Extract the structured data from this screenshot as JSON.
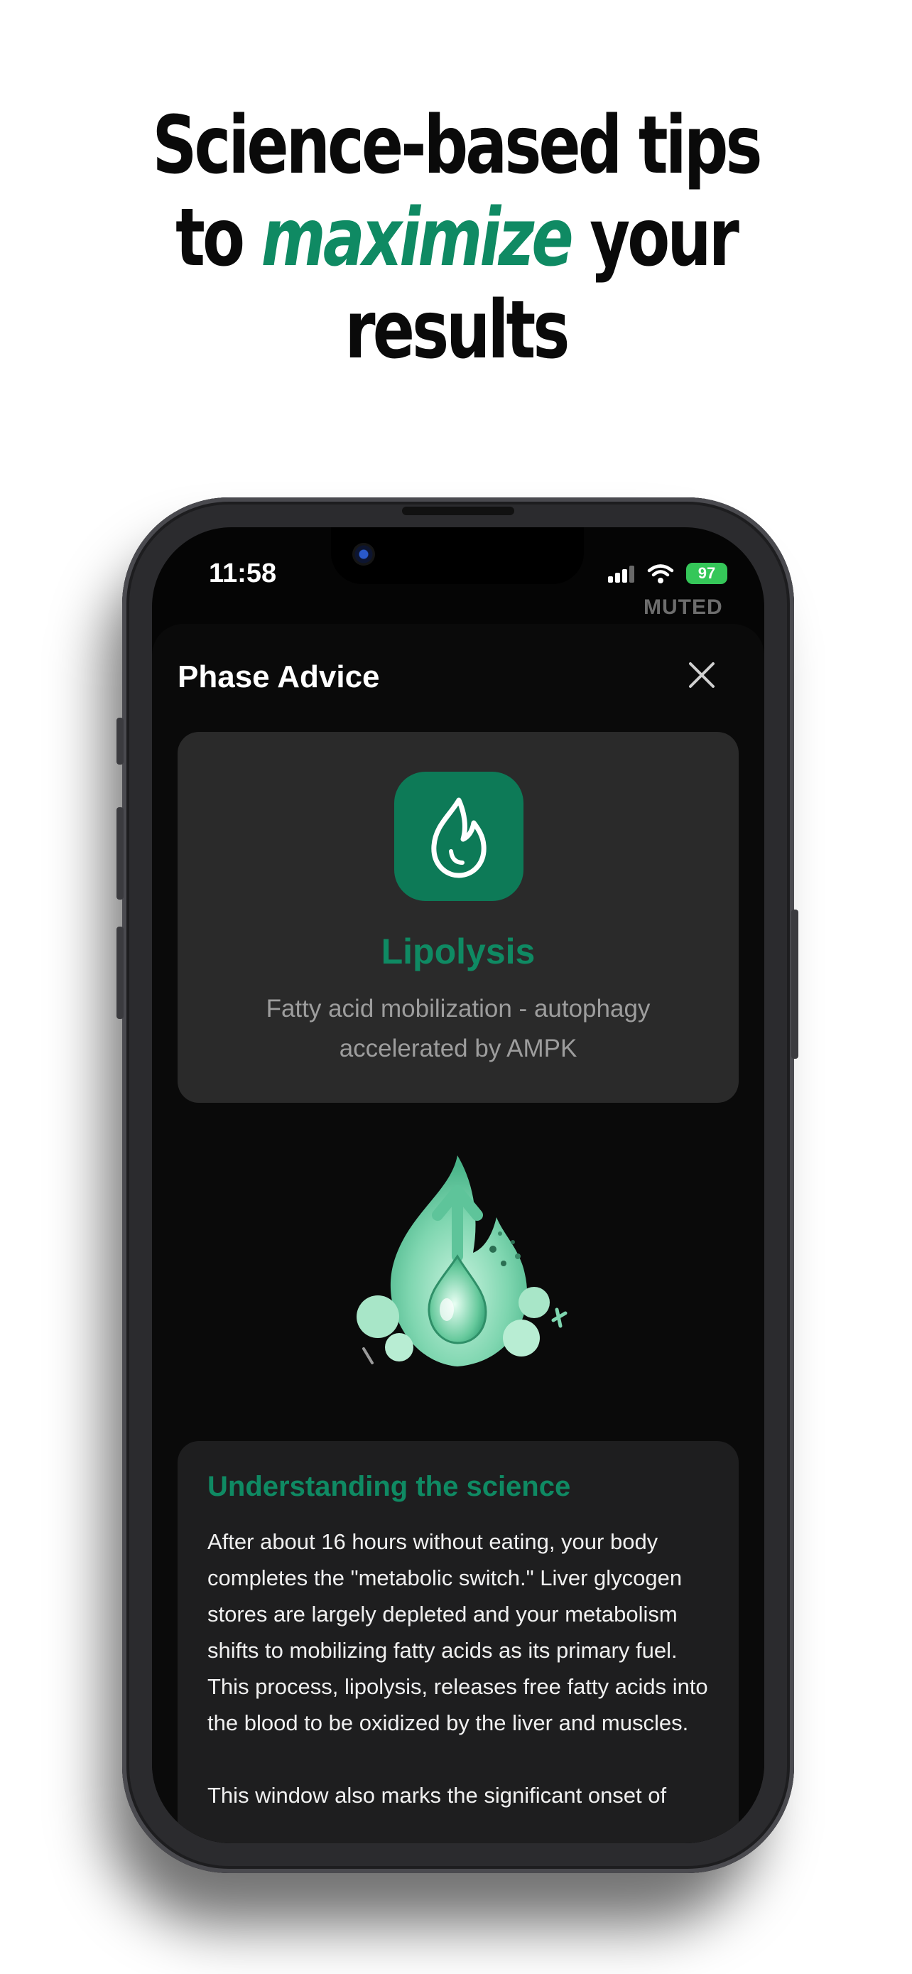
{
  "headline": {
    "line1": "Science-based tips",
    "line2_pre": "to ",
    "line2_accent": "maximize",
    "line2_post": " your",
    "line3": "results"
  },
  "status_bar": {
    "time": "11:58",
    "battery": "97"
  },
  "peek_text": "MUTED",
  "sheet": {
    "title": "Phase Advice"
  },
  "phase": {
    "name": "Lipolysis",
    "description": "Fatty acid mobilization - autophagy accelerated by AMPK",
    "icon": "flame-drop-icon"
  },
  "science": {
    "title": "Understanding the science",
    "paragraph1": "After about 16 hours without eating, your body completes the \"metabolic switch.\" Liver glycogen stores are largely depleted and your metabolism shifts to mobilizing fatty acids as its primary fuel. This process, lipolysis, releases free fatty acids into the blood to be oxidized by the liver and muscles.",
    "paragraph2": "This window also marks the significant onset of"
  },
  "colors": {
    "accent": "#0f8a63",
    "icon_bg": "#0d7a57",
    "card_bg": "#2a2a2a",
    "battery": "#35c759"
  }
}
